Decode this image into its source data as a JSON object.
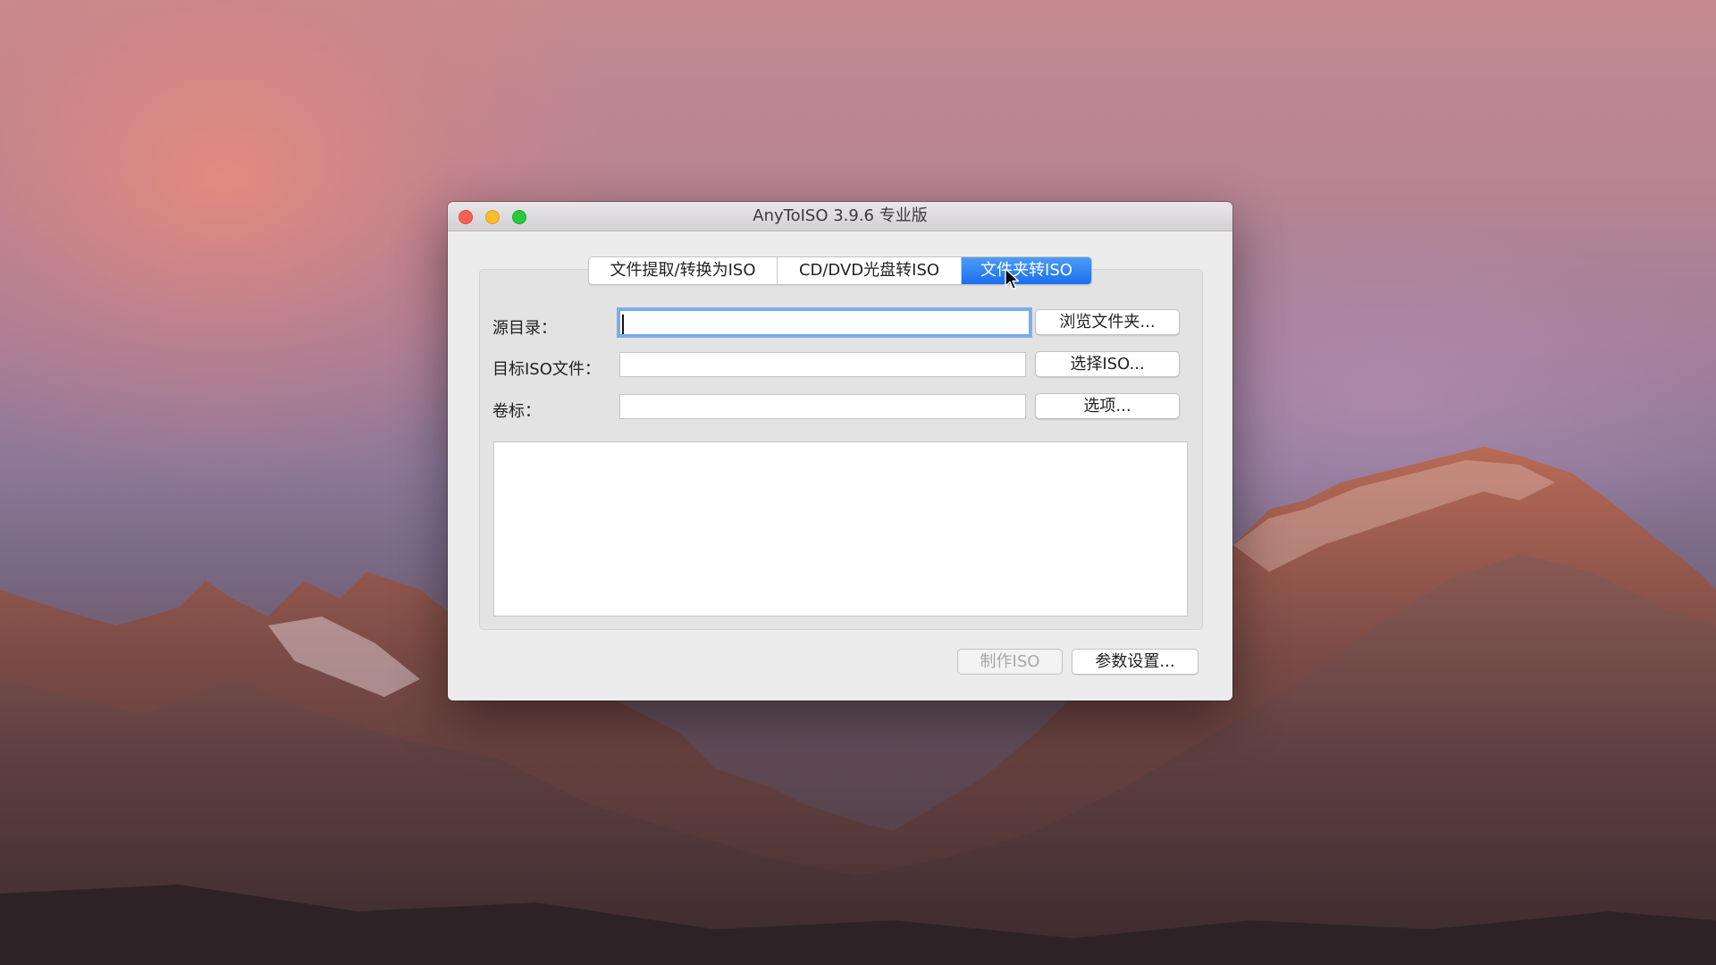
{
  "window": {
    "title": "AnyToISO 3.9.6 专业版"
  },
  "tabs": [
    {
      "label": "文件提取/转换为ISO",
      "active": false
    },
    {
      "label": "CD/DVD光盘转ISO",
      "active": false
    },
    {
      "label": "文件夹转ISO",
      "active": true
    }
  ],
  "form": {
    "source_dir_label": "源目录：",
    "source_dir_value": "",
    "target_iso_label": "目标ISO文件：",
    "target_iso_value": "",
    "volume_label": "卷标：",
    "volume_value": "",
    "browse_folder_button": "浏览文件夹...",
    "choose_iso_button": "选择ISO...",
    "options_button": "选项..."
  },
  "log": {
    "text": ""
  },
  "footer": {
    "make_iso_button": "制作ISO",
    "make_iso_enabled": false,
    "settings_button": "参数设置..."
  },
  "colors": {
    "accent": "#1a6ff1",
    "close": "#fc5f57",
    "minimize": "#fdbb2e",
    "zoom": "#28c83f"
  },
  "icons": {
    "cursor": "arrow-cursor-icon"
  }
}
